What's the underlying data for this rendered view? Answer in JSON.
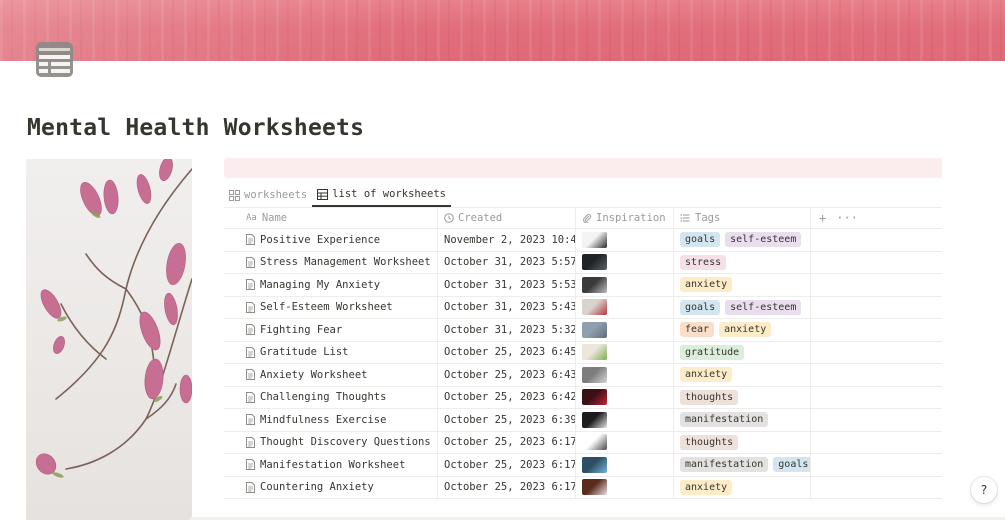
{
  "page": {
    "title": "Mental Health Worksheets",
    "cover": "pink-painted-wall-cover",
    "icon": "calendar-table-icon",
    "side_image": "magnolia-branch-image"
  },
  "views": [
    {
      "label": "worksheets",
      "icon": "gallery-icon",
      "active": false
    },
    {
      "label": "list of worksheets",
      "icon": "table-icon",
      "active": true
    }
  ],
  "table": {
    "columns": [
      {
        "label": "Name",
        "icon": "text-property-icon",
        "icon_text": "Aa"
      },
      {
        "label": "Created",
        "icon": "clock-icon"
      },
      {
        "label": "Inspiration",
        "icon": "paperclip-icon"
      },
      {
        "label": "Tags",
        "icon": "list-icon"
      }
    ],
    "add_symbol": "+",
    "more_symbol": "···",
    "rows": [
      {
        "name": "Positive Experience",
        "created": "November 2, 2023 10:4",
        "thumb": [
          "#f4f4f4",
          "#2a2a2a"
        ],
        "tags": [
          "goals",
          "self-esteem"
        ]
      },
      {
        "name": "Stress Management Worksheet",
        "created": "October 31, 2023 5:57",
        "thumb": [
          "#1f2326",
          "#5a6268"
        ],
        "tags": [
          "stress"
        ]
      },
      {
        "name": "Managing My Anxiety",
        "created": "October 31, 2023 5:53",
        "thumb": [
          "#3a3a3a",
          "#bdbdbd"
        ],
        "tags": [
          "anxiety"
        ]
      },
      {
        "name": "Self-Esteem Worksheet",
        "created": "October 31, 2023 5:43",
        "thumb": [
          "#d9d2cd",
          "#b5333f"
        ],
        "tags": [
          "goals",
          "self-esteem"
        ]
      },
      {
        "name": "Fighting Fear",
        "created": "October 31, 2023 5:32",
        "thumb": [
          "#8ea0b0",
          "#5e6d79"
        ],
        "tags": [
          "fear",
          "anxiety"
        ]
      },
      {
        "name": "Gratitude List",
        "created": "October 25, 2023 6:45",
        "thumb": [
          "#ece6dc",
          "#7fae4f"
        ],
        "tags": [
          "gratitude"
        ]
      },
      {
        "name": "Anxiety Worksheet",
        "created": "October 25, 2023 6:43",
        "thumb": [
          "#7d7d7d",
          "#d6d6d6"
        ],
        "tags": [
          "anxiety"
        ]
      },
      {
        "name": "Challenging Thoughts",
        "created": "October 25, 2023 6:42",
        "thumb": [
          "#3a1016",
          "#c4243c"
        ],
        "tags": [
          "thoughts"
        ]
      },
      {
        "name": "Mindfulness Exercise",
        "created": "October 25, 2023 6:39",
        "thumb": [
          "#1b1b1b",
          "#e5e5e5"
        ],
        "tags": [
          "manifestation"
        ]
      },
      {
        "name": "Thought Discovery Questions",
        "created": "October 25, 2023 6:17",
        "thumb": [
          "#ffffff",
          "#4a4a4a"
        ],
        "tags": [
          "thoughts"
        ]
      },
      {
        "name": "Manifestation Worksheet",
        "created": "October 25, 2023 6:17",
        "thumb": [
          "#2c4e66",
          "#78b6d6"
        ],
        "tags": [
          "manifestation",
          "goals"
        ]
      },
      {
        "name": "Countering Anxiety",
        "created": "October 25, 2023 6:17",
        "thumb": [
          "#5a2a1e",
          "#e9e2dc"
        ],
        "tags": [
          "anxiety"
        ]
      }
    ]
  },
  "tag_colors": {
    "goals": "#d3e5ef",
    "self-esteem": "#e8deee",
    "stress": "#f5e0e9",
    "anxiety": "#fdecc8",
    "fear": "#fadec9",
    "gratitude": "#dbeddb",
    "thoughts": "#eee0da",
    "manifestation": "#e3e2e0"
  },
  "help": {
    "label": "?"
  }
}
